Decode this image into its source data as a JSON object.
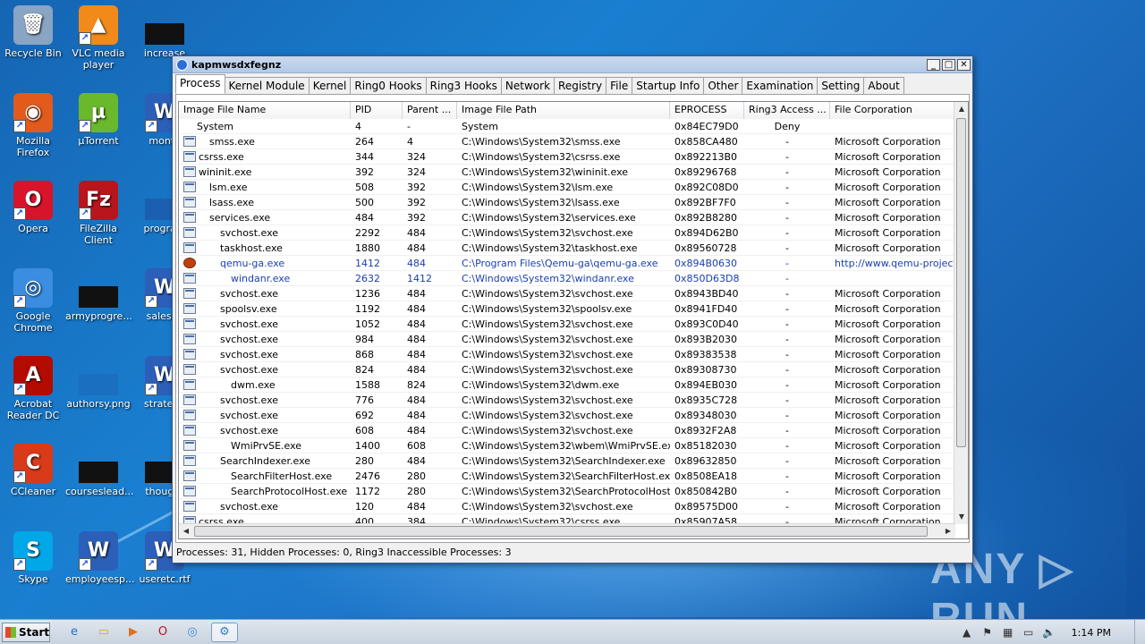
{
  "desktop": {
    "icons": [
      {
        "label": "Recycle Bin",
        "glyph": "🗑"
      },
      {
        "label": "VLC media player",
        "glyph": "▲"
      },
      {
        "label": "increase",
        "glyph": ""
      },
      {
        "label": "Mozilla Firefox",
        "glyph": "◉"
      },
      {
        "label": "µTorrent",
        "glyph": "µ"
      },
      {
        "label": "monty",
        "glyph": "W"
      },
      {
        "label": "Opera",
        "glyph": "O"
      },
      {
        "label": "FileZilla Client",
        "glyph": "Fz"
      },
      {
        "label": "program",
        "glyph": ""
      },
      {
        "label": "Google Chrome",
        "glyph": "◎"
      },
      {
        "label": "armyprogre...",
        "glyph": ""
      },
      {
        "label": "salesco",
        "glyph": "W"
      },
      {
        "label": "Acrobat Reader DC",
        "glyph": "A"
      },
      {
        "label": "authorsy.png",
        "glyph": ""
      },
      {
        "label": "strategy",
        "glyph": "W"
      },
      {
        "label": "CCleaner",
        "glyph": "C"
      },
      {
        "label": "courseslead...",
        "glyph": ""
      },
      {
        "label": "thought",
        "glyph": ""
      },
      {
        "label": "Skype",
        "glyph": "S"
      },
      {
        "label": "employeesp...",
        "glyph": "W"
      },
      {
        "label": "useretc.rtf",
        "glyph": "W"
      }
    ]
  },
  "watermark": "ANY ▷ RUN",
  "window": {
    "title": "kapmwsdxfegnz",
    "controls": {
      "minimize": "_",
      "maximize": "□",
      "close": "✕"
    },
    "tabs": [
      "Process",
      "Kernel Module",
      "Kernel",
      "Ring0 Hooks",
      "Ring3 Hooks",
      "Network",
      "Registry",
      "File",
      "Startup Info",
      "Other",
      "Examination",
      "Setting",
      "About"
    ],
    "columns": [
      "Image File Name",
      "PID",
      "Parent ...",
      "Image File Path",
      "EPROCESS",
      "Ring3 Access ...",
      "File Corporation"
    ],
    "rows": [
      {
        "name": "System",
        "indent": 0,
        "icon": false,
        "pid": "4",
        "ppid": "-",
        "path": "System",
        "eprocess": "0x84EC79D0",
        "ring3": "Deny",
        "corp": "",
        "blue": false
      },
      {
        "name": "smss.exe",
        "indent": 1,
        "icon": true,
        "pid": "264",
        "ppid": "4",
        "path": "C:\\Windows\\System32\\smss.exe",
        "eprocess": "0x858CA480",
        "ring3": "-",
        "corp": "Microsoft Corporation",
        "blue": false
      },
      {
        "name": "csrss.exe",
        "indent": 0,
        "icon": true,
        "pid": "344",
        "ppid": "324",
        "path": "C:\\Windows\\System32\\csrss.exe",
        "eprocess": "0x892213B0",
        "ring3": "-",
        "corp": "Microsoft Corporation",
        "blue": false
      },
      {
        "name": "wininit.exe",
        "indent": 0,
        "icon": true,
        "pid": "392",
        "ppid": "324",
        "path": "C:\\Windows\\System32\\wininit.exe",
        "eprocess": "0x89296768",
        "ring3": "-",
        "corp": "Microsoft Corporation",
        "blue": false
      },
      {
        "name": "lsm.exe",
        "indent": 1,
        "icon": true,
        "pid": "508",
        "ppid": "392",
        "path": "C:\\Windows\\System32\\lsm.exe",
        "eprocess": "0x892C08D0",
        "ring3": "-",
        "corp": "Microsoft Corporation",
        "blue": false
      },
      {
        "name": "lsass.exe",
        "indent": 1,
        "icon": true,
        "pid": "500",
        "ppid": "392",
        "path": "C:\\Windows\\System32\\lsass.exe",
        "eprocess": "0x892BF7F0",
        "ring3": "-",
        "corp": "Microsoft Corporation",
        "blue": false
      },
      {
        "name": "services.exe",
        "indent": 1,
        "icon": true,
        "pid": "484",
        "ppid": "392",
        "path": "C:\\Windows\\System32\\services.exe",
        "eprocess": "0x892B8280",
        "ring3": "-",
        "corp": "Microsoft Corporation",
        "blue": false
      },
      {
        "name": "svchost.exe",
        "indent": 2,
        "icon": true,
        "pid": "2292",
        "ppid": "484",
        "path": "C:\\Windows\\System32\\svchost.exe",
        "eprocess": "0x894D62B0",
        "ring3": "-",
        "corp": "Microsoft Corporation",
        "blue": false
      },
      {
        "name": "taskhost.exe",
        "indent": 2,
        "icon": true,
        "pid": "1880",
        "ppid": "484",
        "path": "C:\\Windows\\System32\\taskhost.exe",
        "eprocess": "0x89560728",
        "ring3": "-",
        "corp": "Microsoft Corporation",
        "blue": false
      },
      {
        "name": "qemu-ga.exe",
        "indent": 2,
        "icon": "q",
        "pid": "1412",
        "ppid": "484",
        "path": "C:\\Program Files\\Qemu-ga\\qemu-ga.exe",
        "eprocess": "0x894B0630",
        "ring3": "-",
        "corp": "http://www.qemu-project...",
        "blue": true
      },
      {
        "name": "windanr.exe",
        "indent": 3,
        "icon": true,
        "pid": "2632",
        "ppid": "1412",
        "path": "C:\\Windows\\System32\\windanr.exe",
        "eprocess": "0x850D63D8",
        "ring3": "-",
        "corp": "",
        "blue": true
      },
      {
        "name": "svchost.exe",
        "indent": 2,
        "icon": true,
        "pid": "1236",
        "ppid": "484",
        "path": "C:\\Windows\\System32\\svchost.exe",
        "eprocess": "0x8943BD40",
        "ring3": "-",
        "corp": "Microsoft Corporation",
        "blue": false
      },
      {
        "name": "spoolsv.exe",
        "indent": 2,
        "icon": true,
        "pid": "1192",
        "ppid": "484",
        "path": "C:\\Windows\\System32\\spoolsv.exe",
        "eprocess": "0x8941FD40",
        "ring3": "-",
        "corp": "Microsoft Corporation",
        "blue": false
      },
      {
        "name": "svchost.exe",
        "indent": 2,
        "icon": true,
        "pid": "1052",
        "ppid": "484",
        "path": "C:\\Windows\\System32\\svchost.exe",
        "eprocess": "0x893C0D40",
        "ring3": "-",
        "corp": "Microsoft Corporation",
        "blue": false
      },
      {
        "name": "svchost.exe",
        "indent": 2,
        "icon": true,
        "pid": "984",
        "ppid": "484",
        "path": "C:\\Windows\\System32\\svchost.exe",
        "eprocess": "0x893B2030",
        "ring3": "-",
        "corp": "Microsoft Corporation",
        "blue": false
      },
      {
        "name": "svchost.exe",
        "indent": 2,
        "icon": true,
        "pid": "868",
        "ppid": "484",
        "path": "C:\\Windows\\System32\\svchost.exe",
        "eprocess": "0x89383538",
        "ring3": "-",
        "corp": "Microsoft Corporation",
        "blue": false
      },
      {
        "name": "svchost.exe",
        "indent": 2,
        "icon": true,
        "pid": "824",
        "ppid": "484",
        "path": "C:\\Windows\\System32\\svchost.exe",
        "eprocess": "0x89308730",
        "ring3": "-",
        "corp": "Microsoft Corporation",
        "blue": false
      },
      {
        "name": "dwm.exe",
        "indent": 3,
        "icon": true,
        "pid": "1588",
        "ppid": "824",
        "path": "C:\\Windows\\System32\\dwm.exe",
        "eprocess": "0x894EB030",
        "ring3": "-",
        "corp": "Microsoft Corporation",
        "blue": false
      },
      {
        "name": "svchost.exe",
        "indent": 2,
        "icon": true,
        "pid": "776",
        "ppid": "484",
        "path": "C:\\Windows\\System32\\svchost.exe",
        "eprocess": "0x8935C728",
        "ring3": "-",
        "corp": "Microsoft Corporation",
        "blue": false
      },
      {
        "name": "svchost.exe",
        "indent": 2,
        "icon": true,
        "pid": "692",
        "ppid": "484",
        "path": "C:\\Windows\\System32\\svchost.exe",
        "eprocess": "0x89348030",
        "ring3": "-",
        "corp": "Microsoft Corporation",
        "blue": false
      },
      {
        "name": "svchost.exe",
        "indent": 2,
        "icon": true,
        "pid": "608",
        "ppid": "484",
        "path": "C:\\Windows\\System32\\svchost.exe",
        "eprocess": "0x8932F2A8",
        "ring3": "-",
        "corp": "Microsoft Corporation",
        "blue": false
      },
      {
        "name": "WmiPrvSE.exe",
        "indent": 3,
        "icon": true,
        "pid": "1400",
        "ppid": "608",
        "path": "C:\\Windows\\System32\\wbem\\WmiPrvSE.exe",
        "eprocess": "0x85182030",
        "ring3": "-",
        "corp": "Microsoft Corporation",
        "blue": false
      },
      {
        "name": "SearchIndexer.exe",
        "indent": 2,
        "icon": true,
        "pid": "280",
        "ppid": "484",
        "path": "C:\\Windows\\System32\\SearchIndexer.exe",
        "eprocess": "0x89632850",
        "ring3": "-",
        "corp": "Microsoft Corporation",
        "blue": false
      },
      {
        "name": "SearchFilterHost.exe",
        "indent": 3,
        "icon": true,
        "pid": "2476",
        "ppid": "280",
        "path": "C:\\Windows\\System32\\SearchFilterHost.exe",
        "eprocess": "0x8508EA18",
        "ring3": "-",
        "corp": "Microsoft Corporation",
        "blue": false
      },
      {
        "name": "SearchProtocolHost.exe",
        "indent": 3,
        "icon": true,
        "pid": "1172",
        "ppid": "280",
        "path": "C:\\Windows\\System32\\SearchProtocolHost....",
        "eprocess": "0x850842B0",
        "ring3": "-",
        "corp": "Microsoft Corporation",
        "blue": false
      },
      {
        "name": "svchost.exe",
        "indent": 2,
        "icon": true,
        "pid": "120",
        "ppid": "484",
        "path": "C:\\Windows\\System32\\svchost.exe",
        "eprocess": "0x89575D00",
        "ring3": "-",
        "corp": "Microsoft Corporation",
        "blue": false
      },
      {
        "name": "csrss.exe",
        "indent": 0,
        "icon": true,
        "pid": "400",
        "ppid": "384",
        "path": "C:\\Windows\\System32\\csrss.exe",
        "eprocess": "0x85907A58",
        "ring3": "-",
        "corp": "Microsoft Corporation",
        "blue": false
      }
    ],
    "scroll_arrows": {
      "up": "▲",
      "down": "▼",
      "left": "◀",
      "right": "▶"
    },
    "status": "Processes: 31, Hidden Processes: 0, Ring3 Inaccessible Processes: 3"
  },
  "taskbar": {
    "start_label": "Start",
    "apps": [
      {
        "name": "internet-explorer",
        "glyph": "e"
      },
      {
        "name": "explorer",
        "glyph": "▭"
      },
      {
        "name": "media-player",
        "glyph": "▶"
      },
      {
        "name": "opera",
        "glyph": "O"
      },
      {
        "name": "chrome",
        "glyph": "◎"
      },
      {
        "name": "pchunter",
        "glyph": "⚙"
      }
    ],
    "tray_icons": [
      {
        "name": "show-hidden",
        "glyph": "▲"
      },
      {
        "name": "flag",
        "glyph": "⚑"
      },
      {
        "name": "network",
        "glyph": "▦"
      },
      {
        "name": "monitor",
        "glyph": "▭"
      },
      {
        "name": "volume",
        "glyph": "🔈"
      }
    ],
    "clock": "1:14 PM"
  }
}
